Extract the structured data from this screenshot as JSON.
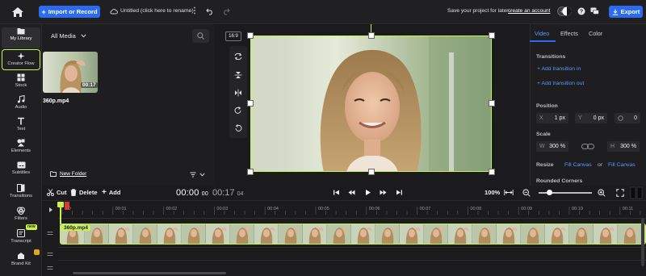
{
  "topbar": {
    "import_label": "Import or Record",
    "project_title": "Untitled (click here to rename)",
    "save_note": "Save your project for later -",
    "create_account": "create an account",
    "export_label": "Export"
  },
  "rail": {
    "items": [
      {
        "label": "My Library",
        "icon": "folder-icon"
      },
      {
        "label": "Creator Flow",
        "icon": "sparkle-icon"
      },
      {
        "label": "Stock",
        "icon": "grid-icon"
      },
      {
        "label": "Audio",
        "icon": "music-icon"
      },
      {
        "label": "Text",
        "icon": "text-icon"
      },
      {
        "label": "Elements",
        "icon": "shapes-icon"
      },
      {
        "label": "Subtitles",
        "icon": "cc-icon"
      },
      {
        "label": "Transitions",
        "icon": "transition-icon"
      },
      {
        "label": "Filters",
        "icon": "filter-icon"
      },
      {
        "label": "Transcript",
        "icon": "transcript-icon"
      },
      {
        "label": "Brand Kit",
        "icon": "brand-icon"
      }
    ],
    "new_badge": "new"
  },
  "media": {
    "filter": "All Media",
    "file_name": "360p.mp4",
    "duration": "00:17",
    "new_folder": "New Folder"
  },
  "stage": {
    "aspect": "16:9"
  },
  "right_panel": {
    "tabs": [
      "Video",
      "Effects",
      "Color"
    ],
    "transitions_title": "Transitions",
    "add_transition_in": "Add transition in",
    "add_transition_out": "Add transition out",
    "position_title": "Position",
    "position": {
      "x_label": "X",
      "x_value": "1 px",
      "y_label": "Y",
      "y_value": "0 px",
      "rot_value": "0"
    },
    "scale_title": "Scale",
    "scale": {
      "w_label": "W",
      "w_value": "300 %",
      "h_label": "H",
      "h_value": "300 %"
    },
    "resize_title": "Resize",
    "fill_canvas": "Fill Canvas",
    "or": "or",
    "fill_canvas_2": "Fill Canvas",
    "rounded_title": "Rounded Corners"
  },
  "timeline_toolbar": {
    "cut": "Cut",
    "delete": "Delete",
    "add": "Add",
    "time_current": "00:00",
    "time_current_frames": "00",
    "time_total": "00:17",
    "time_total_frames": "04",
    "zoom": "100%",
    "zoom_slider_level": 0.2
  },
  "timeline": {
    "ticks": [
      ":00",
      "00:01",
      "00:02",
      "00:03",
      "00:04",
      "00:05",
      "00:06",
      "00:07",
      "00:08",
      "00:09",
      "00:10",
      "00:11"
    ],
    "clip_label": "360p.mp4"
  },
  "colors": {
    "accent": "#2c6bf0",
    "highlight": "#c9f24b",
    "link": "#5a9bff"
  }
}
